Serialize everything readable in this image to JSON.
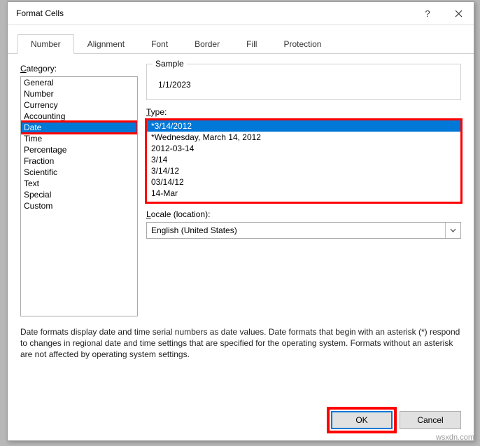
{
  "title": "Format Cells",
  "tabs": [
    "Number",
    "Alignment",
    "Font",
    "Border",
    "Fill",
    "Protection"
  ],
  "active_tab": 0,
  "category_label": "Category:",
  "categories": [
    "General",
    "Number",
    "Currency",
    "Accounting",
    "Date",
    "Time",
    "Percentage",
    "Fraction",
    "Scientific",
    "Text",
    "Special",
    "Custom"
  ],
  "selected_category": 4,
  "sample_label": "Sample",
  "sample_value": "1/1/2023",
  "type_label": "Type:",
  "types": [
    "*3/14/2012",
    "*Wednesday, March 14, 2012",
    "2012-03-14",
    "3/14",
    "3/14/12",
    "03/14/12",
    "14-Mar"
  ],
  "selected_type": 0,
  "locale_label": "Locale (location):",
  "locale_value": "English (United States)",
  "description": "Date formats display date and time serial numbers as date values.  Date formats that begin with an asterisk (*) respond to changes in regional date and time settings that are specified for the operating system. Formats without an asterisk are not affected by operating system settings.",
  "ok_label": "OK",
  "cancel_label": "Cancel",
  "watermark": "wsxdn.com"
}
